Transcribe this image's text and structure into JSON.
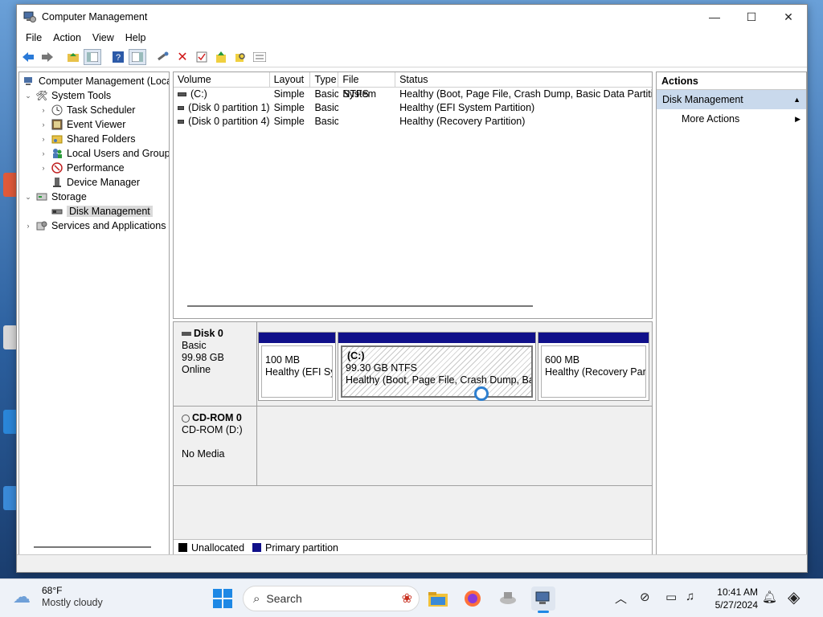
{
  "window": {
    "title": "Computer Management",
    "controls": {
      "minimize": "—",
      "maximize": "☐",
      "close": "✕"
    }
  },
  "menu": [
    "File",
    "Action",
    "View",
    "Help"
  ],
  "tree": {
    "root": "Computer Management (Local",
    "items": [
      {
        "label": "System Tools",
        "icon": "tools-icon"
      },
      {
        "label": "Task Scheduler",
        "icon": "clock-icon"
      },
      {
        "label": "Event Viewer",
        "icon": "event-viewer-icon"
      },
      {
        "label": "Shared Folders",
        "icon": "shared-folders-icon"
      },
      {
        "label": "Local Users and Groups",
        "icon": "users-icon"
      },
      {
        "label": "Performance",
        "icon": "performance-icon"
      },
      {
        "label": "Device Manager",
        "icon": "device-manager-icon"
      },
      {
        "label": "Storage",
        "icon": "storage-icon"
      },
      {
        "label": "Disk Management",
        "icon": "disk-management-icon"
      },
      {
        "label": "Services and Applications",
        "icon": "services-icon"
      }
    ]
  },
  "volumes": {
    "headers": [
      "Volume",
      "Layout",
      "Type",
      "File System",
      "Status"
    ],
    "rows": [
      {
        "volume": "(C:)",
        "layout": "Simple",
        "type": "Basic",
        "fs": "NTFS",
        "status": "Healthy (Boot, Page File, Crash Dump, Basic Data Partition)"
      },
      {
        "volume": "(Disk 0 partition 1)",
        "layout": "Simple",
        "type": "Basic",
        "fs": "",
        "status": "Healthy (EFI System Partition)"
      },
      {
        "volume": "(Disk 0 partition 4)",
        "layout": "Simple",
        "type": "Basic",
        "fs": "",
        "status": "Healthy (Recovery Partition)"
      }
    ]
  },
  "disks": {
    "disk0": {
      "name": "Disk 0",
      "type": "Basic",
      "size": "99.98 GB",
      "state": "Online"
    },
    "cdrom0": {
      "name": "CD-ROM 0",
      "drive": "CD-ROM (D:)",
      "media": "No Media"
    },
    "partitions": [
      {
        "line1": "",
        "line2": "100 MB",
        "line3": "Healthy (EFI Sys"
      },
      {
        "line1": "(C:)",
        "line2": "99.30 GB NTFS",
        "line3": "Healthy (Boot, Page File, Crash Dump, Basic"
      },
      {
        "line1": "",
        "line2": "600 MB",
        "line3": "Healthy (Recovery Partit"
      }
    ]
  },
  "legend": [
    {
      "label": "Unallocated",
      "color": "#000000"
    },
    {
      "label": "Primary partition",
      "color": "#10108a"
    }
  ],
  "actions": {
    "header": "Actions",
    "section": "Disk Management",
    "item": "More Actions"
  },
  "taskbar": {
    "temperature": "68°F",
    "condition": "Mostly cloudy",
    "search_label": "Search",
    "time": "10:41 AM",
    "date": "5/27/2024"
  }
}
